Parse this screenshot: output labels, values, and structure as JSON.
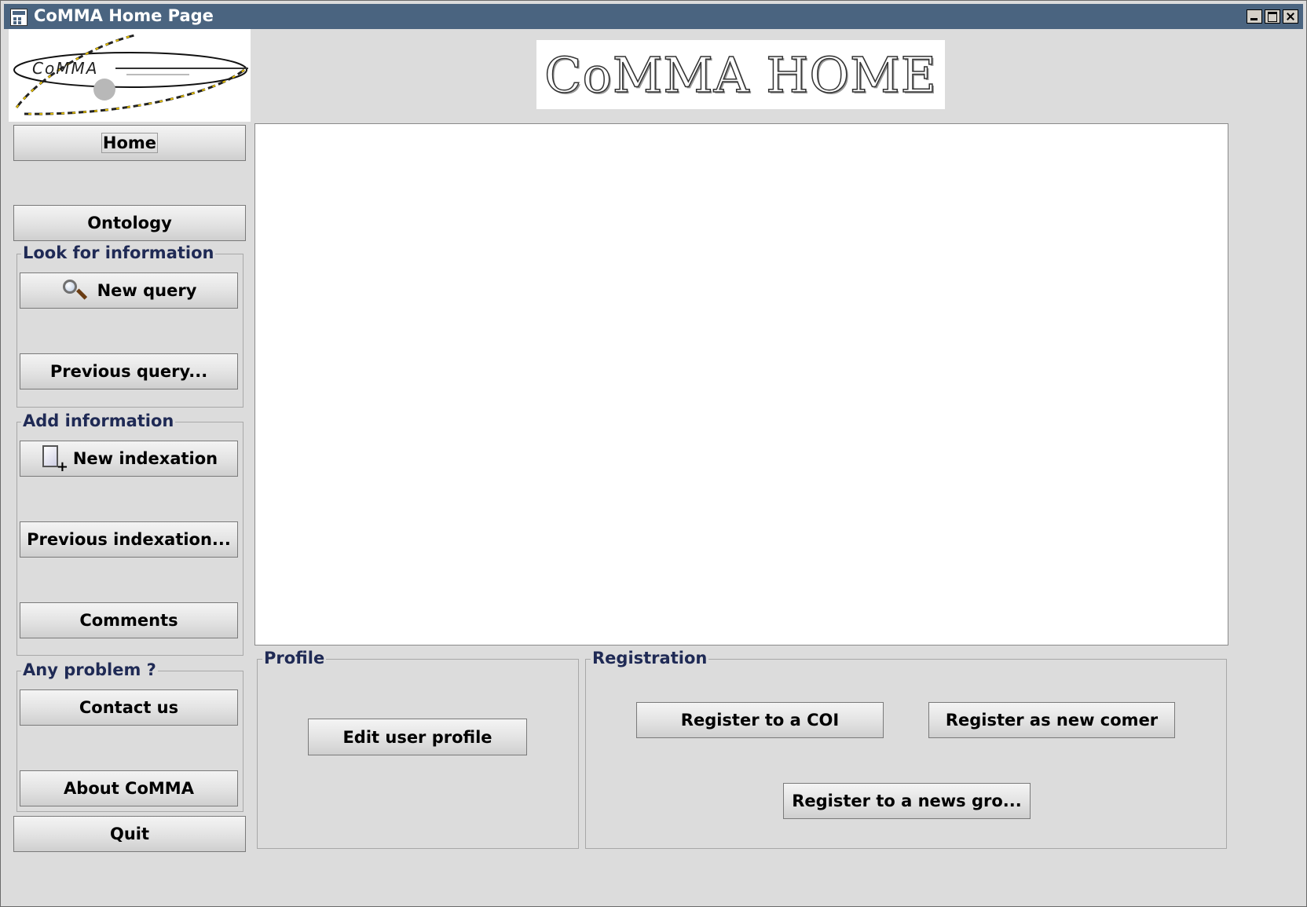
{
  "window": {
    "title": "CoMMA Home Page"
  },
  "logo": {
    "text": "CoMMA"
  },
  "banner": {
    "text": "CoMMA HOME"
  },
  "sidebar": {
    "home": "Home",
    "ontology": "Ontology",
    "look_for_information": {
      "title": "Look for information",
      "new_query": "New query",
      "previous_query": "Previous query..."
    },
    "add_information": {
      "title": "Add information",
      "new_indexation": "New indexation",
      "previous_indexation": "Previous indexation...",
      "comments": "Comments"
    },
    "any_problem": {
      "title": "Any problem ?",
      "contact_us": "Contact us",
      "about": "About CoMMA"
    },
    "quit": "Quit"
  },
  "profile": {
    "title": "Profile",
    "edit_user_profile": "Edit user profile"
  },
  "registration": {
    "title": "Registration",
    "register_coi": "Register to a COI",
    "register_new_comer": "Register as new comer",
    "register_news_group": "Register to a news gro..."
  },
  "colors": {
    "titlebar": "#4a6480",
    "panel": "#dcdcdc",
    "group_title": "#1f2a55"
  }
}
